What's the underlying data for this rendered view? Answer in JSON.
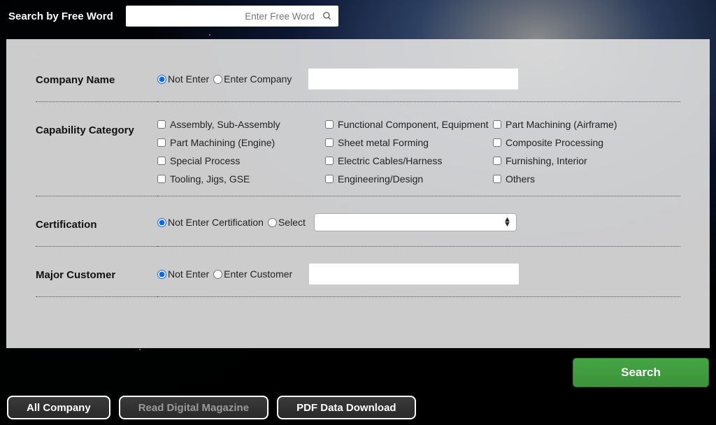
{
  "topbar": {
    "label": "Search by Free Word",
    "placeholder": "Enter Free Word"
  },
  "form": {
    "company": {
      "label": "Company Name",
      "opt_not_enter": "Not Enter",
      "opt_enter": "Enter Company"
    },
    "capability": {
      "label": "Capability Category",
      "items": [
        "Assembly, Sub-Assembly",
        "Functional Component, Equipment",
        "Part Machining (Airframe)",
        "Part Machining (Engine)",
        "Sheet metal Forming",
        "Composite Processing",
        "Special Process",
        "Electric Cables/Harness",
        "Furnishing, Interior",
        "Tooling, Jigs, GSE",
        "Engineering/Design",
        "Others"
      ]
    },
    "certification": {
      "label": "Certification",
      "opt_not_enter": "Not Enter Certification",
      "opt_select": "Select"
    },
    "customer": {
      "label": "Major Customer",
      "opt_not_enter": "Not Enter",
      "opt_enter": "Enter Customer"
    }
  },
  "actions": {
    "search": "Search"
  },
  "footer": {
    "all_company": "All Company",
    "read_magazine": "Read Digital Magazine",
    "pdf_download": "PDF Data Download"
  }
}
